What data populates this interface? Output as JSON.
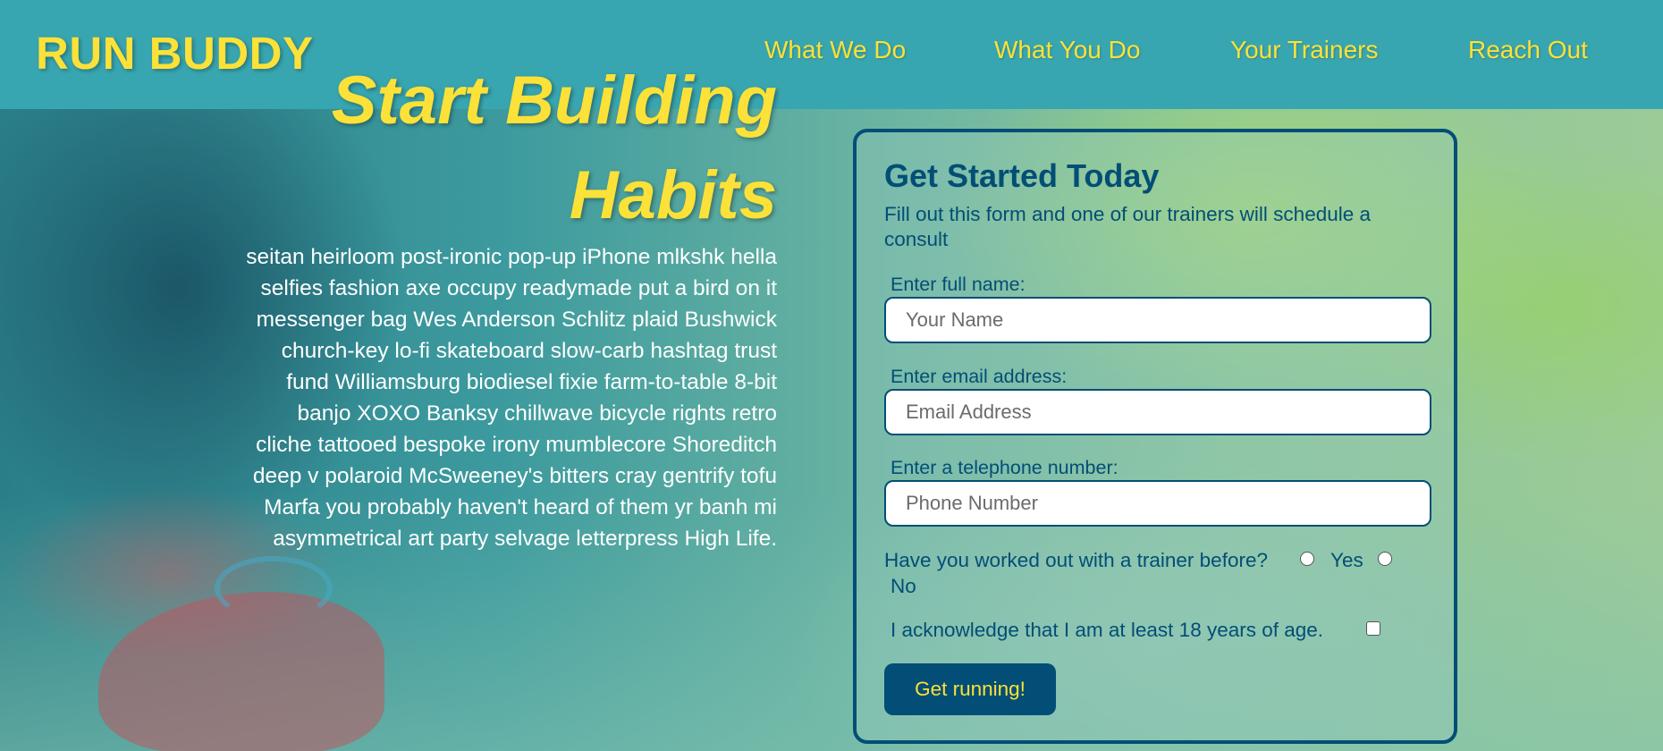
{
  "header": {
    "logo": "RUN BUDDY",
    "nav": [
      {
        "label": "What We Do"
      },
      {
        "label": "What You Do"
      },
      {
        "label": "Your Trainers"
      },
      {
        "label": "Reach Out"
      }
    ]
  },
  "hero": {
    "title_line1": "Start Building",
    "title_line2": "Habits",
    "body": "seitan heirloom post-ironic pop-up iPhone mlkshk hella selfies fashion axe occupy readymade put a bird on it messenger bag Wes Anderson Schlitz plaid Bushwick church-key lo-fi skateboard slow-carb hashtag trust fund Williamsburg biodiesel fixie farm-to-table 8-bit banjo XOXO Banksy chillwave bicycle rights retro cliche tattooed bespoke irony mumblecore Shoreditch deep v polaroid McSweeney's bitters cray gentrify tofu Marfa you probably haven't heard of them yr banh mi asymmetrical art party selvage letterpress High Life."
  },
  "form": {
    "title": "Get Started Today",
    "subtitle": "Fill out this form and one of our trainers will schedule a consult",
    "name_label": "Enter full name:",
    "name_placeholder": "Your Name",
    "email_label": "Enter email address:",
    "email_placeholder": "Email Address",
    "phone_label": "Enter a telephone number:",
    "phone_placeholder": "Phone Number",
    "trainer_question": "Have you worked out with a trainer before?",
    "yes_label": "Yes",
    "no_label": "No",
    "ack_label": "I acknowledge that I am at least 18 years of age.",
    "submit_label": "Get running!"
  },
  "colors": {
    "header_bg": "#38a6b0",
    "accent_yellow": "#fce138",
    "dark_blue": "#024e76"
  }
}
